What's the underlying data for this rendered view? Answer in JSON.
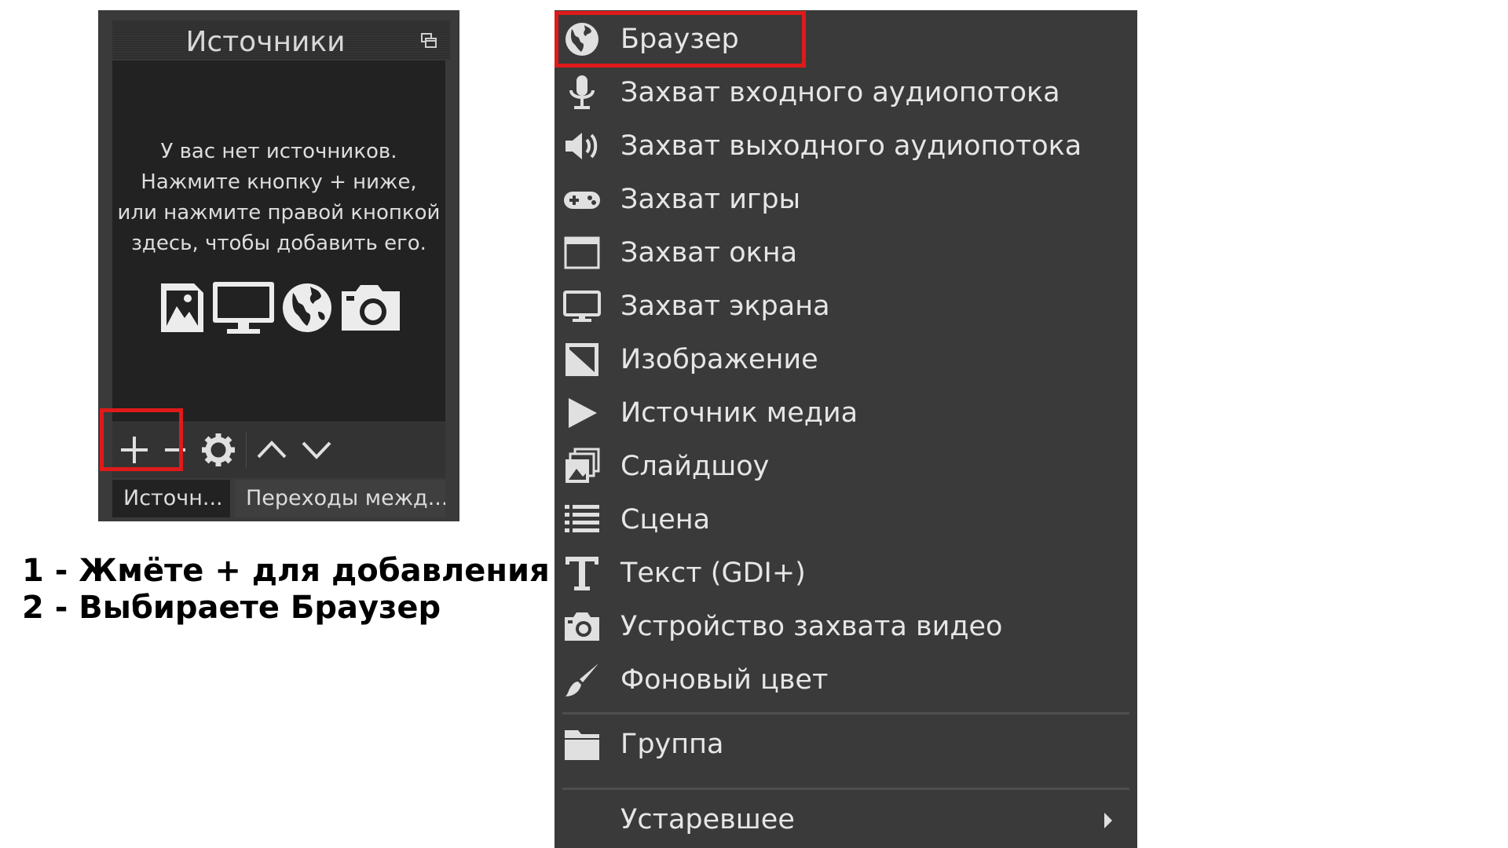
{
  "sources_dock": {
    "title": "Источники",
    "empty_message_lines": [
      "У вас нет источников.",
      "Нажмите кнопку + ниже,",
      "или нажмите правой кнопкой",
      "здесь, чтобы добавить его."
    ],
    "empty_icons": [
      "image-icon",
      "monitor-icon",
      "globe-icon",
      "camera-icon"
    ],
    "toolbar": [
      "plus-icon",
      "minus-icon",
      "gear-icon",
      "chevron-up-icon",
      "chevron-down-icon"
    ],
    "tabs": {
      "sources": "Источн...",
      "transitions": "Переходы межд..."
    }
  },
  "instructions": {
    "step1": "1 - Жмёте + для добавления",
    "step2": "2 - Выбираете Браузер"
  },
  "context_menu": {
    "items": [
      {
        "label": "Браузер",
        "icon": "globe-icon"
      },
      {
        "label": "Захват входного аудиопотока",
        "icon": "microphone-icon"
      },
      {
        "label": "Захват выходного аудиопотока",
        "icon": "speaker-icon"
      },
      {
        "label": "Захват игры",
        "icon": "gamepad-icon"
      },
      {
        "label": "Захват окна",
        "icon": "window-icon"
      },
      {
        "label": "Захват экрана",
        "icon": "monitor-icon"
      },
      {
        "label": "Изображение",
        "icon": "image-icon"
      },
      {
        "label": "Источник медиа",
        "icon": "play-icon"
      },
      {
        "label": "Слайдшоу",
        "icon": "slideshow-icon"
      },
      {
        "label": "Сцена",
        "icon": "list-icon"
      },
      {
        "label": "Текст (GDI+)",
        "icon": "text-icon"
      },
      {
        "label": "Устройство захвата видео",
        "icon": "camera-icon"
      },
      {
        "label": "Фоновый цвет",
        "icon": "brush-icon"
      }
    ],
    "group": {
      "label": "Группа",
      "icon": "folder-icon"
    },
    "deprecated": {
      "label": "Устаревшее",
      "icon": "chevron-right-icon"
    }
  },
  "colors": {
    "highlight": "#e01a1a",
    "menu_bg": "#3a3a3a",
    "panel_bg": "#222222",
    "text": "#e6e6e6"
  }
}
